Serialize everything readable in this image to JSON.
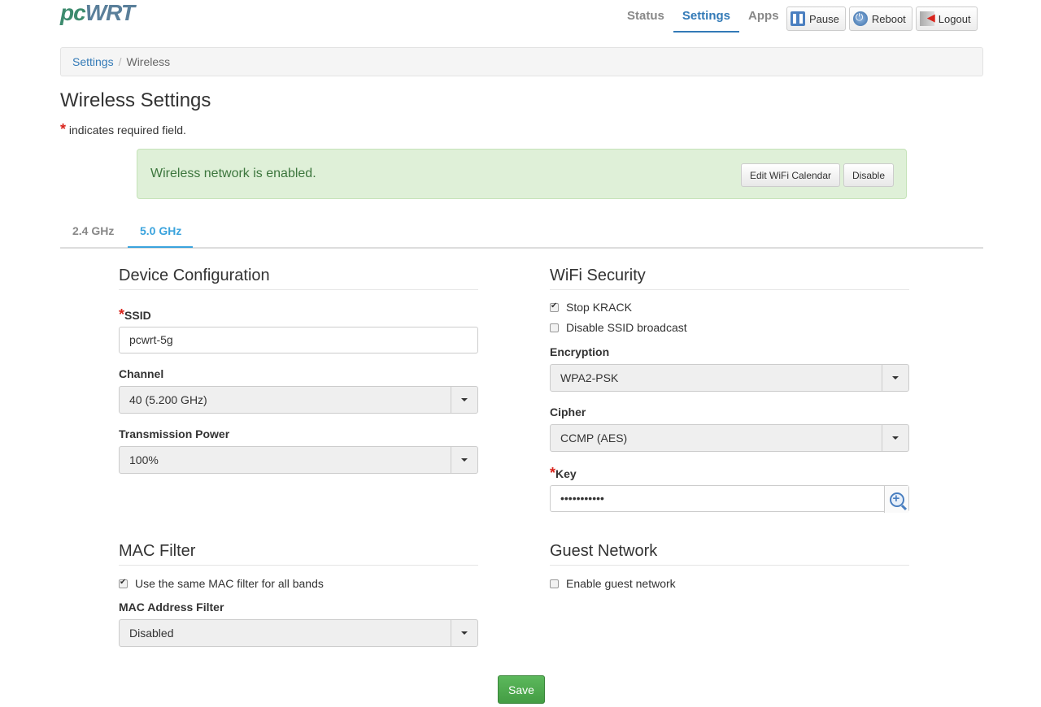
{
  "logo": {
    "pc": "pc",
    "wrt": "WRT"
  },
  "nav": {
    "status": "Status",
    "settings": "Settings",
    "apps": "Apps"
  },
  "topbuttons": {
    "pause": "Pause",
    "reboot": "Reboot",
    "logout": "Logout"
  },
  "breadcrumb": {
    "root": "Settings",
    "sep": "/",
    "current": "Wireless"
  },
  "page": {
    "title": "Wireless Settings",
    "required_star": "*",
    "required_note": "indicates required field."
  },
  "alert": {
    "message": "Wireless network is enabled.",
    "calendar_btn": "Edit WiFi Calendar",
    "disable_btn": "Disable"
  },
  "tabs": {
    "band24": "2.4 GHz",
    "band50": "5.0 GHz"
  },
  "device_config": {
    "heading": "Device Configuration",
    "ssid_label": "SSID",
    "ssid_value": "pcwrt-5g",
    "channel_label": "Channel",
    "channel_value": "40 (5.200 GHz)",
    "power_label": "Transmission Power",
    "power_value": "100%"
  },
  "wifi_security": {
    "heading": "WiFi Security",
    "stop_krack": "Stop KRACK",
    "disable_ssid": "Disable SSID broadcast",
    "encryption_label": "Encryption",
    "encryption_value": "WPA2-PSK",
    "cipher_label": "Cipher",
    "cipher_value": "CCMP (AES)",
    "key_label": "Key",
    "key_value": "•••••••••••"
  },
  "mac_filter": {
    "heading": "MAC Filter",
    "same_filter": "Use the same MAC filter for all bands",
    "filter_label": "MAC Address Filter",
    "filter_value": "Disabled"
  },
  "guest": {
    "heading": "Guest Network",
    "enable": "Enable guest network"
  },
  "save_label": "Save"
}
